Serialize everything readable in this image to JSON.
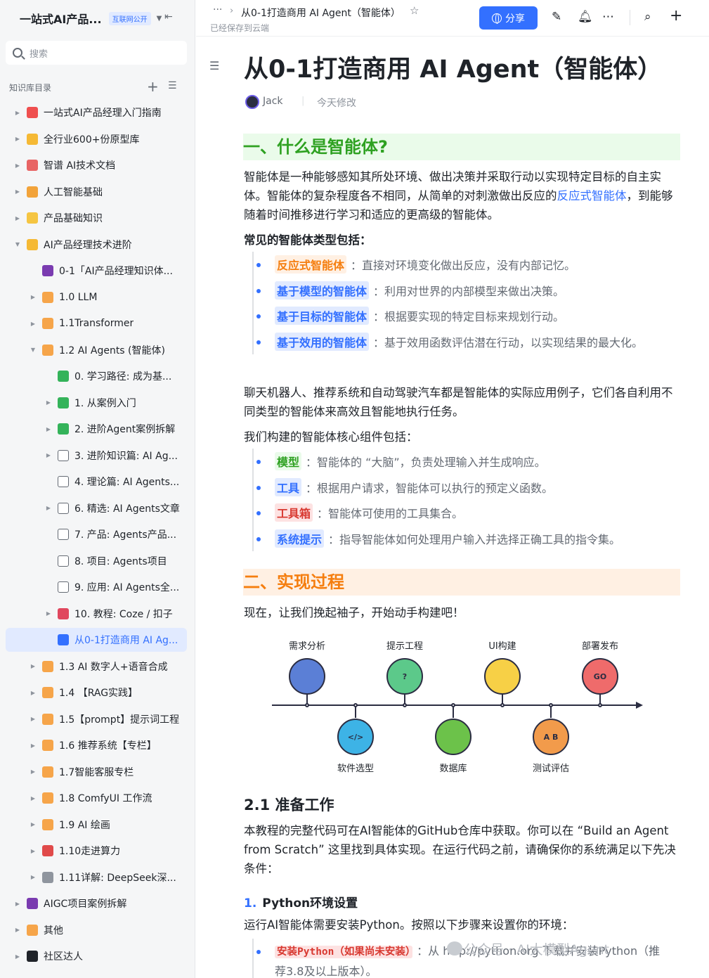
{
  "sidebar": {
    "title": "一站式AI产品...",
    "badge": "互联网公开",
    "search_placeholder": "搜索",
    "section_label": "知识库目录",
    "items": [
      {
        "label": "一站式AI产品经理入门指南",
        "icon": "target-icon"
      },
      {
        "label": "全行业600+份原型库",
        "icon": "flex-arm-icon"
      },
      {
        "label": "智谱 AI技术文档",
        "icon": "calendar-icon"
      },
      {
        "label": "人工智能基础",
        "icon": "heart-eyes-icon"
      },
      {
        "label": "产品基础知识",
        "icon": "moon-icon"
      },
      {
        "label": "AI产品经理技术进阶",
        "icon": "flex-arm-icon"
      },
      {
        "label": "0-1「AI产品经理知识体...",
        "icon": "floppy-disk-icon"
      },
      {
        "label": "1.0 LLM",
        "icon": "folder-icon"
      },
      {
        "label": "1.1Transformer",
        "icon": "folder-icon"
      },
      {
        "label": "1.2 AI Agents (智能体)",
        "icon": "folder-icon"
      },
      {
        "label": "0. 学习路径: 成为基...",
        "icon": "sheet-icon"
      },
      {
        "label": "1. 从案例入门",
        "icon": "sheet-icon"
      },
      {
        "label": "2. 进阶Agent案例拆解",
        "icon": "sheet-icon"
      },
      {
        "label": "3. 进阶知识篇: AI Ag...",
        "icon": "doc-icon"
      },
      {
        "label": "4. 理论篇: AI Agents...",
        "icon": "doc-icon"
      },
      {
        "label": "6. 精选: AI Agents文章",
        "icon": "doc-icon"
      },
      {
        "label": "7. 产品: Agents产品...",
        "icon": "doc-icon"
      },
      {
        "label": "8. 项目: Agents项目",
        "icon": "doc-icon"
      },
      {
        "label": "9. 应用: AI Agents全...",
        "icon": "doc-icon"
      },
      {
        "label": "10. 教程: Coze / 扣子",
        "icon": "coze-icon"
      },
      {
        "label": "从0-1打造商用 AI Ag...",
        "icon": "doc-icon"
      },
      {
        "label": "1.3 AI 数字人+语音合成",
        "icon": "folder-icon"
      },
      {
        "label": "1.4 【RAG实践】",
        "icon": "folder-icon"
      },
      {
        "label": "1.5【prompt】提示词工程",
        "icon": "folder-icon"
      },
      {
        "label": "1.6 推荐系统【专栏】",
        "icon": "folder-icon"
      },
      {
        "label": "1.7智能客服专栏",
        "icon": "folder-icon"
      },
      {
        "label": "1.8 ComfyUI 工作流",
        "icon": "folder-icon"
      },
      {
        "label": "1.9 AI 绘画",
        "icon": "folder-icon"
      },
      {
        "label": "1.10走进算力",
        "icon": "rocket-icon"
      },
      {
        "label": "1.11详解: DeepSeek深...",
        "icon": "gear-icon"
      },
      {
        "label": "AIGC项目案例拆解",
        "icon": "floppy-disk-icon"
      },
      {
        "label": "其他",
        "icon": "folder-icon"
      },
      {
        "label": "社区达人",
        "icon": "eyes-icon"
      }
    ]
  },
  "topbar": {
    "more": "···",
    "breadcrumb_sep": "›",
    "doc_title": "从0-1打造商用 AI Agent（智能体）",
    "saved": "已经保存到云端",
    "share_label": "分享"
  },
  "doc": {
    "title": "从0-1打造商用 AI Agent（智能体）",
    "author": "Jack",
    "modified": "今天修改",
    "h1_1": "一、什么是智能体?",
    "p1_a": "智能体是一种能够感知其所处环境、做出决策并采取行动以实现特定目标的自主实体。智能体的复杂程度各不相同，从简单的对刺激做出反应的",
    "p1_link": "反应式智能体",
    "p1_b": "，到能够随着时间推移进行学习和适应的更高级的智能体。",
    "types_heading": "常见的智能体类型包括：",
    "types": [
      {
        "tag": "反应式智能体",
        "text": "：直接对环境变化做出反应，没有内部记忆。"
      },
      {
        "tag": "基于模型的智能体",
        "text": "：利用对世界的内部模型来做出决策。"
      },
      {
        "tag": "基于目标的智能体",
        "text": "：根据要实现的特定目标来规划行动。"
      },
      {
        "tag": "基于效用的智能体",
        "text": "：基于效用函数评估潜在行动，以实现结果的最大化。"
      }
    ],
    "p2": "聊天机器人、推荐系统和自动驾驶汽车都是智能体的实际应用例子，它们各自利用不同类型的智能体来高效且智能地执行任务。",
    "components_heading": "我们构建的智能体核心组件包括：",
    "components": [
      {
        "tag": "模型",
        "text": "：智能体的 “大脑”，负责处理输入并生成响应。"
      },
      {
        "tag": "工具",
        "text": "：根据用户请求，智能体可以执行的预定义函数。"
      },
      {
        "tag": "工具箱",
        "text": "：智能体可使用的工具集合。"
      },
      {
        "tag": "系统提示",
        "text": "：指导智能体如何处理用户输入并选择正确工具的指令集。"
      }
    ],
    "h1_2": "二、实现过程",
    "p3": "现在，让我们挽起袖子，开始动手构建吧！",
    "diagram": {
      "top_labels": [
        "需求分析",
        "提示工程",
        "UI构建",
        "部署发布"
      ],
      "bottom_labels": [
        "软件选型",
        "数据库",
        "测试评估"
      ],
      "top_colors": [
        "#5b7fd6",
        "#5cc98a",
        "#f7d046",
        "#ef6b6b"
      ],
      "bottom_colors": [
        "#3db3e6",
        "#6cc24a",
        "#f29b4b"
      ],
      "icon_text": [
        "",
        "?",
        "",
        "GO",
        "</>",
        "",
        "A B"
      ]
    },
    "h2_1": "2.1 准备工作",
    "p4": "本教程的完整代码可在AI智能体的GitHub仓库中获取。你可以在 “Build an Agent from Scratch” 这里找到具体实现。在运行代码之前，请确保你的系统满足以下先决条件：",
    "h3_num": "1.",
    "h3_1": "Python环境设置",
    "p5": "运行AI智能体需要安装Python。按照以下步骤来设置你的环境：",
    "install_tag": "安装Python（如果尚未安装）",
    "install_text": "：从 http://python.org 下载并安装Python（推",
    "install_text_2": "荐3.8及以上版本）。",
    "watermark": "公众号 · AI大模型Agent"
  }
}
